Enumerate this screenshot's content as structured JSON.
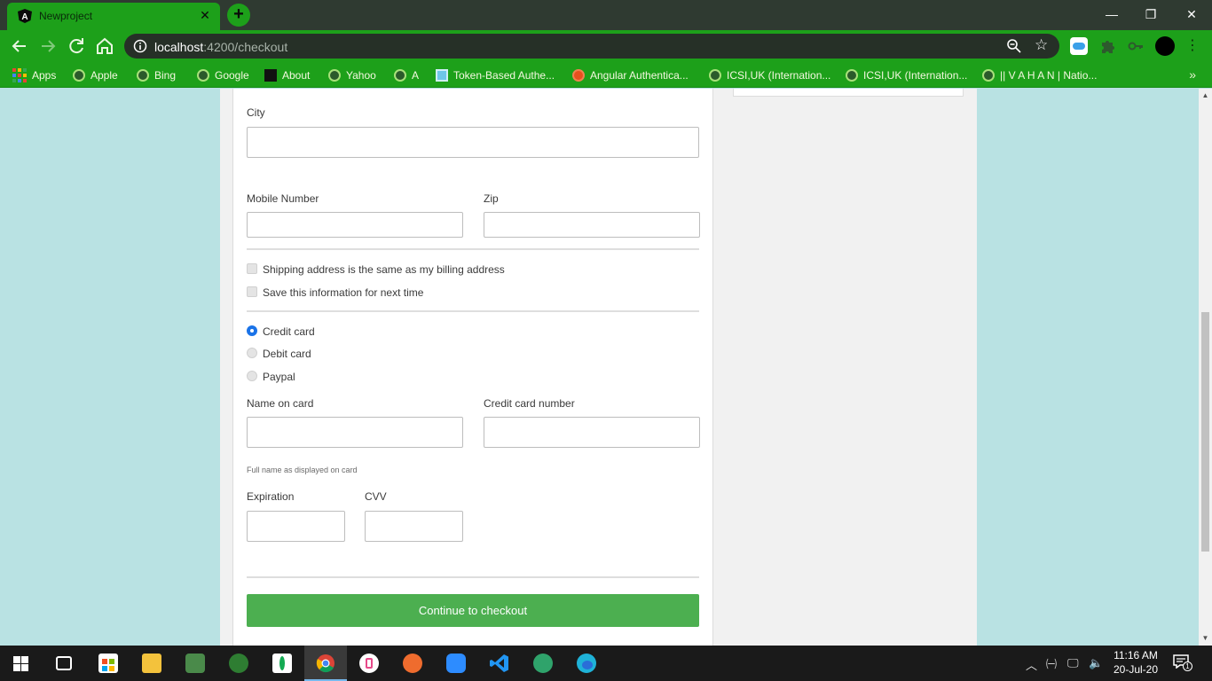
{
  "browser": {
    "tab_title": "Newproject",
    "url_host": "localhost",
    "url_rest": ":4200/checkout",
    "bookmarks": [
      {
        "label": "Apps"
      },
      {
        "label": "Apple"
      },
      {
        "label": "Bing"
      },
      {
        "label": "Google"
      },
      {
        "label": "About"
      },
      {
        "label": "Yahoo"
      },
      {
        "label": "A"
      },
      {
        "label": "Token-Based Authe..."
      },
      {
        "label": "Angular Authentica..."
      },
      {
        "label": "ICSI,UK (Internation..."
      },
      {
        "label": "ICSI,UK (Internation..."
      },
      {
        "label": "|| V A H A N | Natio..."
      }
    ],
    "colors": {
      "frame": "#2f3a31",
      "accent": "#1da01a",
      "omnibox": "#263027"
    }
  },
  "form": {
    "city_label": "City",
    "mobile_label": "Mobile Number",
    "zip_label": "Zip",
    "same_address_label": "Shipping address is the same as my billing address",
    "save_info_label": "Save this information for next time",
    "payment_options": [
      {
        "label": "Credit card",
        "selected": true
      },
      {
        "label": "Debit card",
        "selected": false
      },
      {
        "label": "Paypal",
        "selected": false
      }
    ],
    "name_on_card_label": "Name on card",
    "name_on_card_help": "Full name as displayed on card",
    "card_number_label": "Credit card number",
    "expiration_label": "Expiration",
    "cvv_label": "CVV",
    "submit_label": "Continue to checkout",
    "colors": {
      "submit": "#4caf50",
      "radio_selected": "#1a73e8"
    }
  },
  "taskbar": {
    "time": "11:16 AM",
    "date": "20-Jul-20",
    "notifications": "1"
  }
}
